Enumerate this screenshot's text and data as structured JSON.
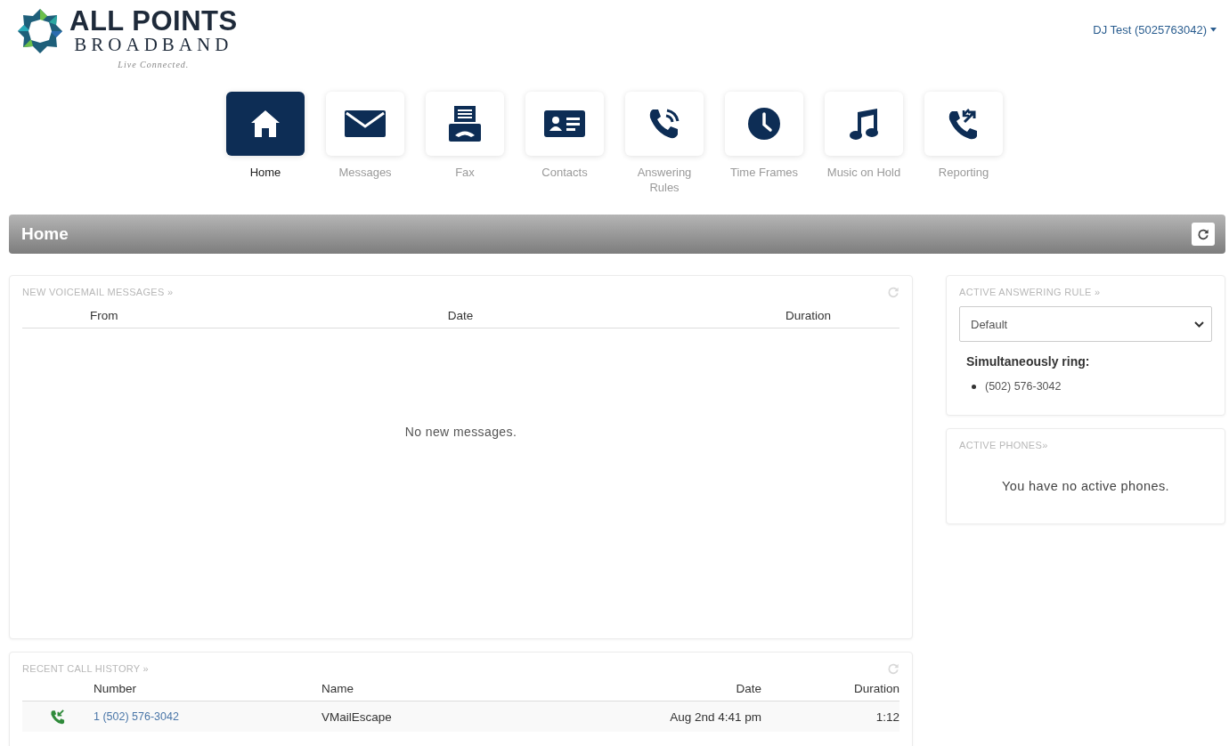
{
  "brand": {
    "name": "ALL POINTS",
    "subname": "BROADBAND",
    "tagline": "Live Connected."
  },
  "user_menu": {
    "label": "DJ Test (5025763042)"
  },
  "nav": [
    {
      "label": "Home",
      "selected": true
    },
    {
      "label": "Messages",
      "selected": false
    },
    {
      "label": "Fax",
      "selected": false
    },
    {
      "label": "Contacts",
      "selected": false
    },
    {
      "label": "Answering Rules",
      "selected": false
    },
    {
      "label": "Time Frames",
      "selected": false
    },
    {
      "label": "Music on Hold",
      "selected": false
    },
    {
      "label": "Reporting",
      "selected": false
    }
  ],
  "page_header": {
    "title": "Home"
  },
  "voicemail": {
    "title": "NEW VOICEMAIL MESSAGES »",
    "columns": [
      "From",
      "Date",
      "Duration"
    ],
    "empty_text": "No new messages."
  },
  "answering_rule": {
    "title": "ACTIVE ANSWERING RULE »",
    "select_value": "Default",
    "ring_label": "Simultaneously ring:",
    "ring_numbers": [
      "(502) 576-3042"
    ]
  },
  "active_phones": {
    "title": "ACTIVE PHONES»",
    "empty_text": "You have no active phones."
  },
  "call_history": {
    "title": "RECENT CALL HISTORY »",
    "columns": [
      "Number",
      "Name",
      "Date",
      "Duration"
    ],
    "rows": [
      {
        "kind": "inbound",
        "number": "1 (502) 576-3042",
        "name": "VMailEscape",
        "date": "Aug 2nd 4:41 pm",
        "duration": "1:12"
      }
    ]
  }
}
